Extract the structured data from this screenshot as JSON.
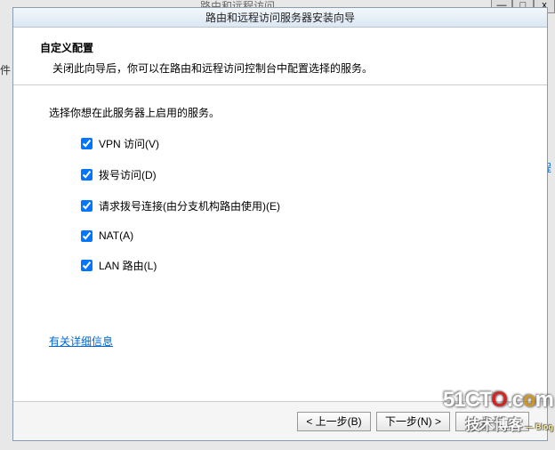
{
  "bg": {
    "title": "路由和远程访问",
    "left_edge": "件",
    "right_edge": "程",
    "win_min": "—",
    "win_max": "□",
    "win_close": "x"
  },
  "dialog": {
    "title": "路由和远程访问服务器安装向导",
    "header_title": "自定义配置",
    "header_sub": "关闭此向导后，你可以在路由和远程访问控制台中配置选择的服务。",
    "prompt": "选择你想在此服务器上启用的服务。",
    "options": [
      {
        "label": "VPN 访问(V)",
        "checked": true
      },
      {
        "label": "拨号访问(D)",
        "checked": true
      },
      {
        "label": "请求拨号连接(由分支机构路由使用)(E)",
        "checked": true
      },
      {
        "label": "NAT(A)",
        "checked": true
      },
      {
        "label": "LAN 路由(L)",
        "checked": true
      }
    ],
    "more_link": "有关详细信息",
    "buttons": {
      "back": "< 上一步(B)",
      "next": "下一步(N) >",
      "cancel": "取消"
    }
  },
  "watermark": {
    "line1_a": "51CT",
    "line1_o1": "O",
    "line1_b": ".c",
    "line1_o2": "o",
    "line1_c": "m",
    "line2": "技术博客",
    "blog": "— Blog"
  }
}
